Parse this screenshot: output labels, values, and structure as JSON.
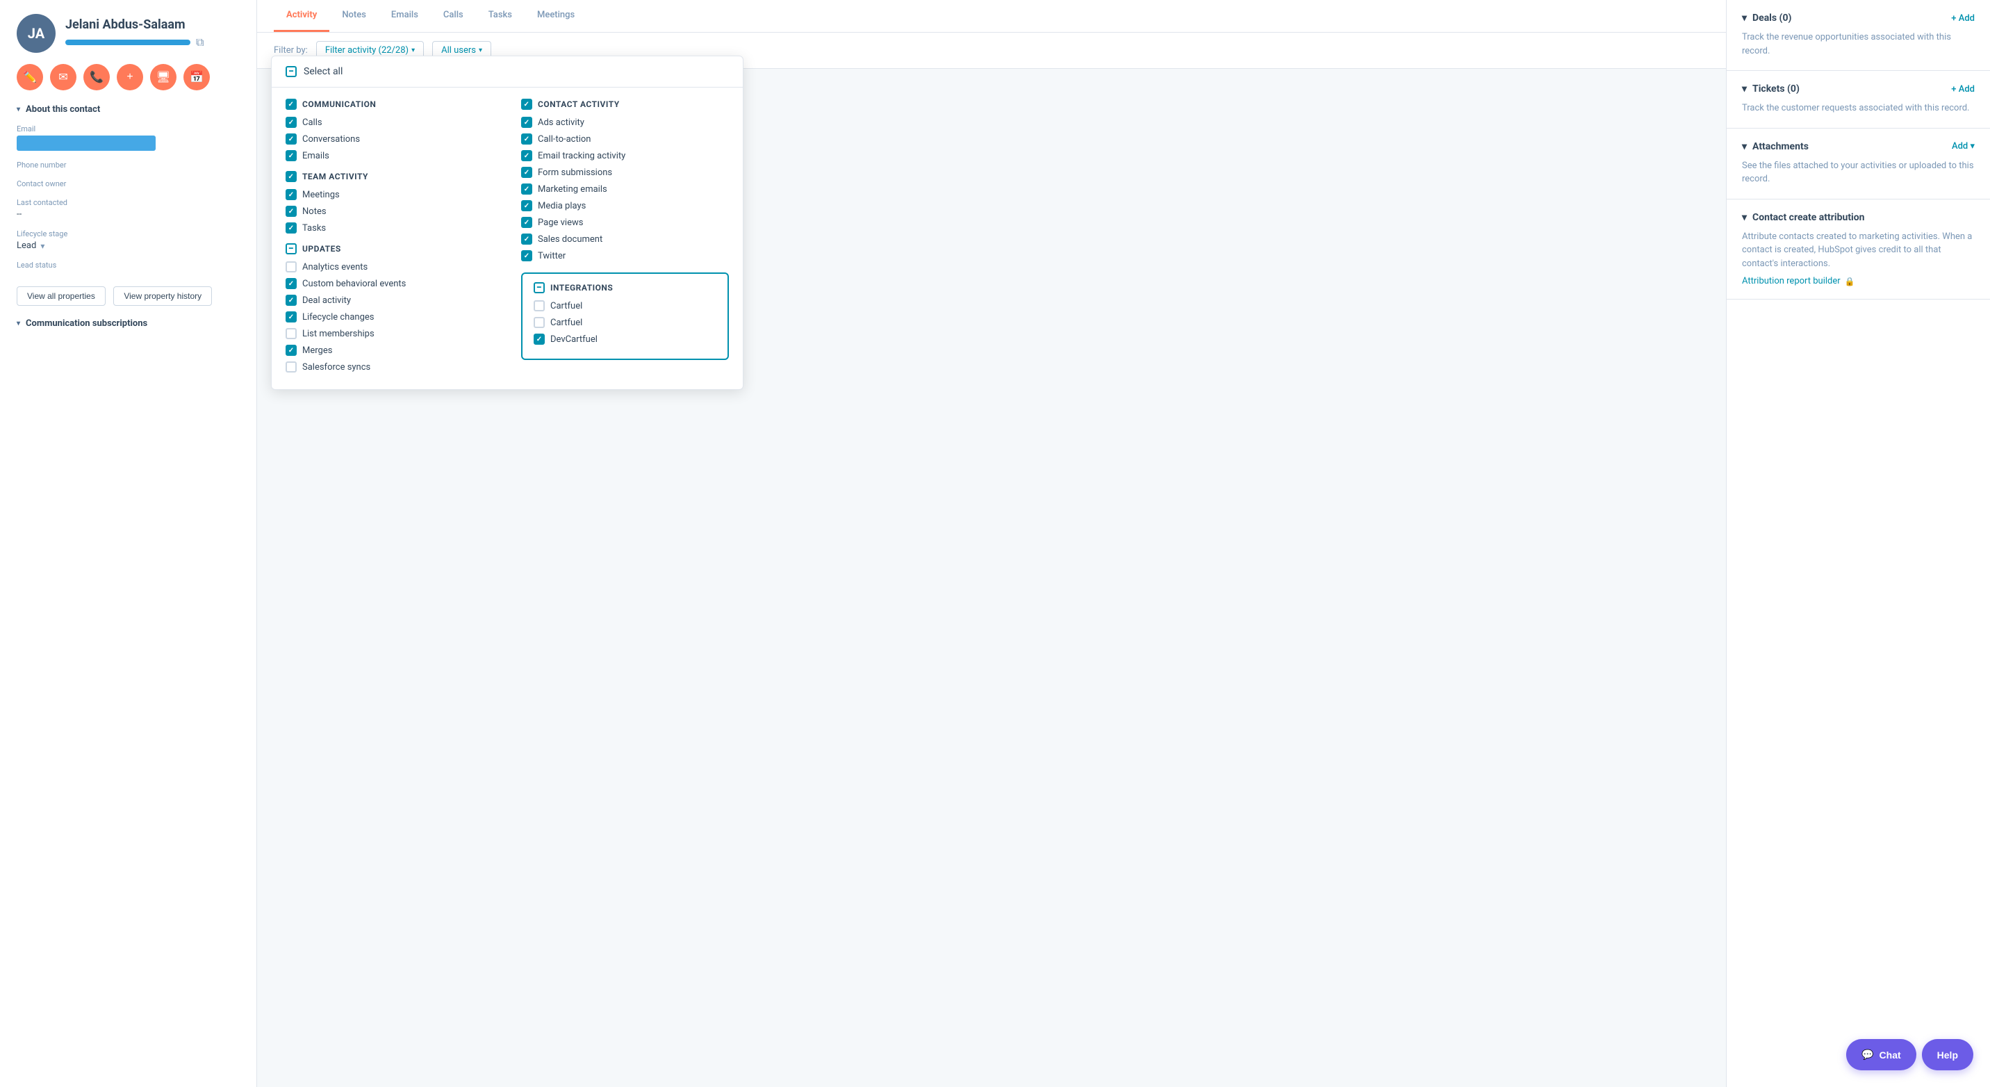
{
  "contact": {
    "initials": "JA",
    "name": "Jelani Abdus-Salaam",
    "avatar_bg": "#516f90"
  },
  "sidebar": {
    "about_label": "About this contact",
    "email_label": "Email",
    "phone_label": "Phone number",
    "owner_label": "Contact owner",
    "last_contacted_label": "Last contacted",
    "last_contacted_value": "--",
    "lifecycle_label": "Lifecycle stage",
    "lifecycle_value": "Lead",
    "lead_status_label": "Lead status",
    "view_all_btn": "View all properties",
    "view_history_btn": "View property history",
    "comm_subscriptions_label": "Communication subscriptions"
  },
  "tabs": [
    {
      "label": "Activity",
      "active": true
    },
    {
      "label": "Notes",
      "active": false
    },
    {
      "label": "Emails",
      "active": false
    },
    {
      "label": "Calls",
      "active": false
    },
    {
      "label": "Tasks",
      "active": false
    },
    {
      "label": "Meetings",
      "active": false
    }
  ],
  "toolbar": {
    "filter_by_label": "Filter by:",
    "filter_activity_label": "Filter activity (22/28)",
    "all_users_label": "All users"
  },
  "dropdown": {
    "select_all_label": "Select all",
    "sections": [
      {
        "id": "communication",
        "title": "COMMUNICATION",
        "checked": true,
        "items": [
          {
            "label": "Calls",
            "checked": true
          },
          {
            "label": "Conversations",
            "checked": true
          },
          {
            "label": "Emails",
            "checked": true
          }
        ]
      },
      {
        "id": "team_activity",
        "title": "TEAM ACTIVITY",
        "checked": true,
        "items": [
          {
            "label": "Meetings",
            "checked": true
          },
          {
            "label": "Notes",
            "checked": true
          },
          {
            "label": "Tasks",
            "checked": true
          }
        ]
      },
      {
        "id": "contact_activity",
        "title": "CONTACT ACTIVITY",
        "checked": true,
        "items": [
          {
            "label": "Ads activity",
            "checked": true
          },
          {
            "label": "Call-to-action",
            "checked": true
          },
          {
            "label": "Email tracking activity",
            "checked": true
          },
          {
            "label": "Form submissions",
            "checked": true
          },
          {
            "label": "Marketing emails",
            "checked": true
          },
          {
            "label": "Media plays",
            "checked": true
          },
          {
            "label": "Page views",
            "checked": true
          },
          {
            "label": "Sales document",
            "checked": true
          },
          {
            "label": "Twitter",
            "checked": true
          }
        ]
      },
      {
        "id": "updates",
        "title": "UPDATES",
        "indeterminate": true,
        "items": [
          {
            "label": "Analytics events",
            "checked": false
          },
          {
            "label": "Custom behavioral events",
            "checked": true
          },
          {
            "label": "Deal activity",
            "checked": true
          },
          {
            "label": "Lifecycle changes",
            "checked": true
          },
          {
            "label": "List memberships",
            "checked": false
          },
          {
            "label": "Merges",
            "checked": true
          },
          {
            "label": "Salesforce syncs",
            "checked": false
          }
        ]
      },
      {
        "id": "integrations",
        "title": "INTEGRATIONS",
        "indeterminate": true,
        "highlighted": true,
        "items": [
          {
            "label": "Cartfuel",
            "checked": false
          },
          {
            "label": "Cartfuel",
            "checked": false
          },
          {
            "label": "DevCartfuel",
            "checked": true
          }
        ]
      }
    ]
  },
  "right_panel": {
    "sections": [
      {
        "id": "deals",
        "title": "Deals (0)",
        "add_label": "+ Add",
        "description": "Track the revenue opportunities associated with this record."
      },
      {
        "id": "tickets",
        "title": "Tickets (0)",
        "add_label": "+ Add",
        "description": "Track the customer requests associated with this record."
      },
      {
        "id": "attachments",
        "title": "Attachments",
        "add_label": "Add",
        "add_arrow": "▾",
        "description": "See the files attached to your activities or uploaded to this record."
      },
      {
        "id": "contact_create_attribution",
        "title": "Contact create attribution",
        "description": "Attribute contacts created to marketing activities. When a contact is created, HubSpot gives credit to all that contact's interactions.",
        "attribution_link": "Attribution report builder",
        "has_lock": true
      }
    ]
  },
  "bottom_buttons": [
    {
      "id": "chat",
      "label": "Chat",
      "icon": "💬"
    },
    {
      "id": "help",
      "label": "Help"
    }
  ]
}
